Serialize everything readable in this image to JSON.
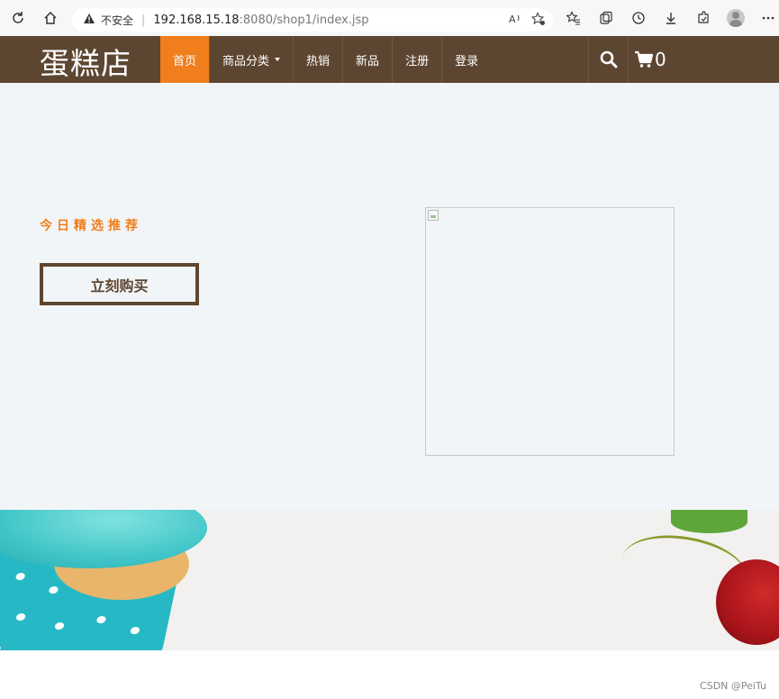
{
  "browser": {
    "security_label": "不安全",
    "url_host": "192.168.15.18",
    "url_rest": ":8080/shop1/index.jsp"
  },
  "site": {
    "brand": "蛋糕店",
    "menu": [
      {
        "label": "首页",
        "active": true
      },
      {
        "label": "商品分类",
        "dropdown": true
      },
      {
        "label": "热销"
      },
      {
        "label": "新品"
      },
      {
        "label": "注册"
      },
      {
        "label": "登录"
      }
    ],
    "cart_count": "0"
  },
  "hero": {
    "title": "今日精选推荐",
    "buy_label": "立刻购买"
  },
  "credit": "CSDN @PeiTu",
  "colors": {
    "nav_bg": "#5d4631",
    "accent": "#f07e1c",
    "hero_bg": "#f2f5f7"
  }
}
